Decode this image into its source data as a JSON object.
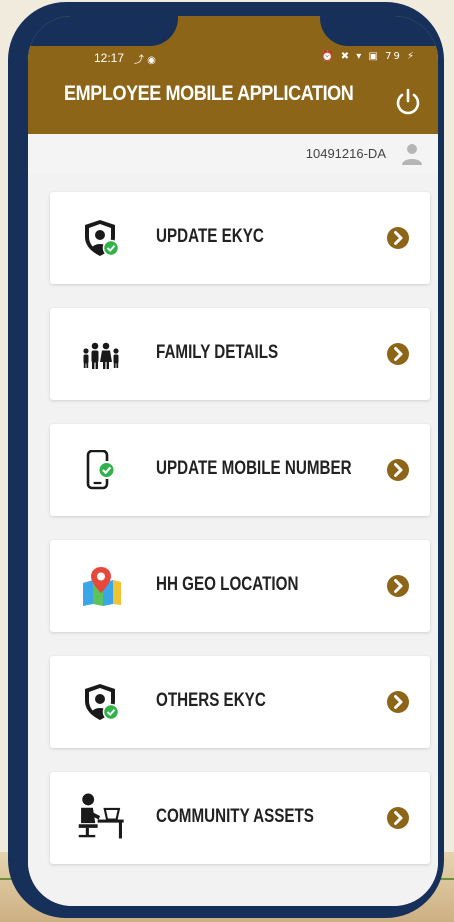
{
  "status_bar": {
    "time": "12:17",
    "left_icons": "⤴ ◉",
    "right_icons": "⏰ ✖ ▾ ▣ 79 ⚡"
  },
  "header": {
    "title": "EMPLOYEE MOBILE APPLICATION"
  },
  "user": {
    "code": "10491216-DA"
  },
  "menu": [
    {
      "label": "UPDATE EKYC",
      "icon": "shield-user-check-icon"
    },
    {
      "label": "FAMILY DETAILS",
      "icon": "family-icon"
    },
    {
      "label": "UPDATE MOBILE NUMBER",
      "icon": "mobile-check-icon"
    },
    {
      "label": "HH GEO LOCATION",
      "icon": "map-pin-icon"
    },
    {
      "label": "OTHERS EKYC",
      "icon": "shield-user-check-icon"
    },
    {
      "label": "COMMUNITY ASSETS",
      "icon": "person-at-desk-icon"
    }
  ],
  "colors": {
    "header": "#8c6518",
    "accent": "#8c6518",
    "bezel": "#17305a",
    "check": "#2fb24a"
  }
}
